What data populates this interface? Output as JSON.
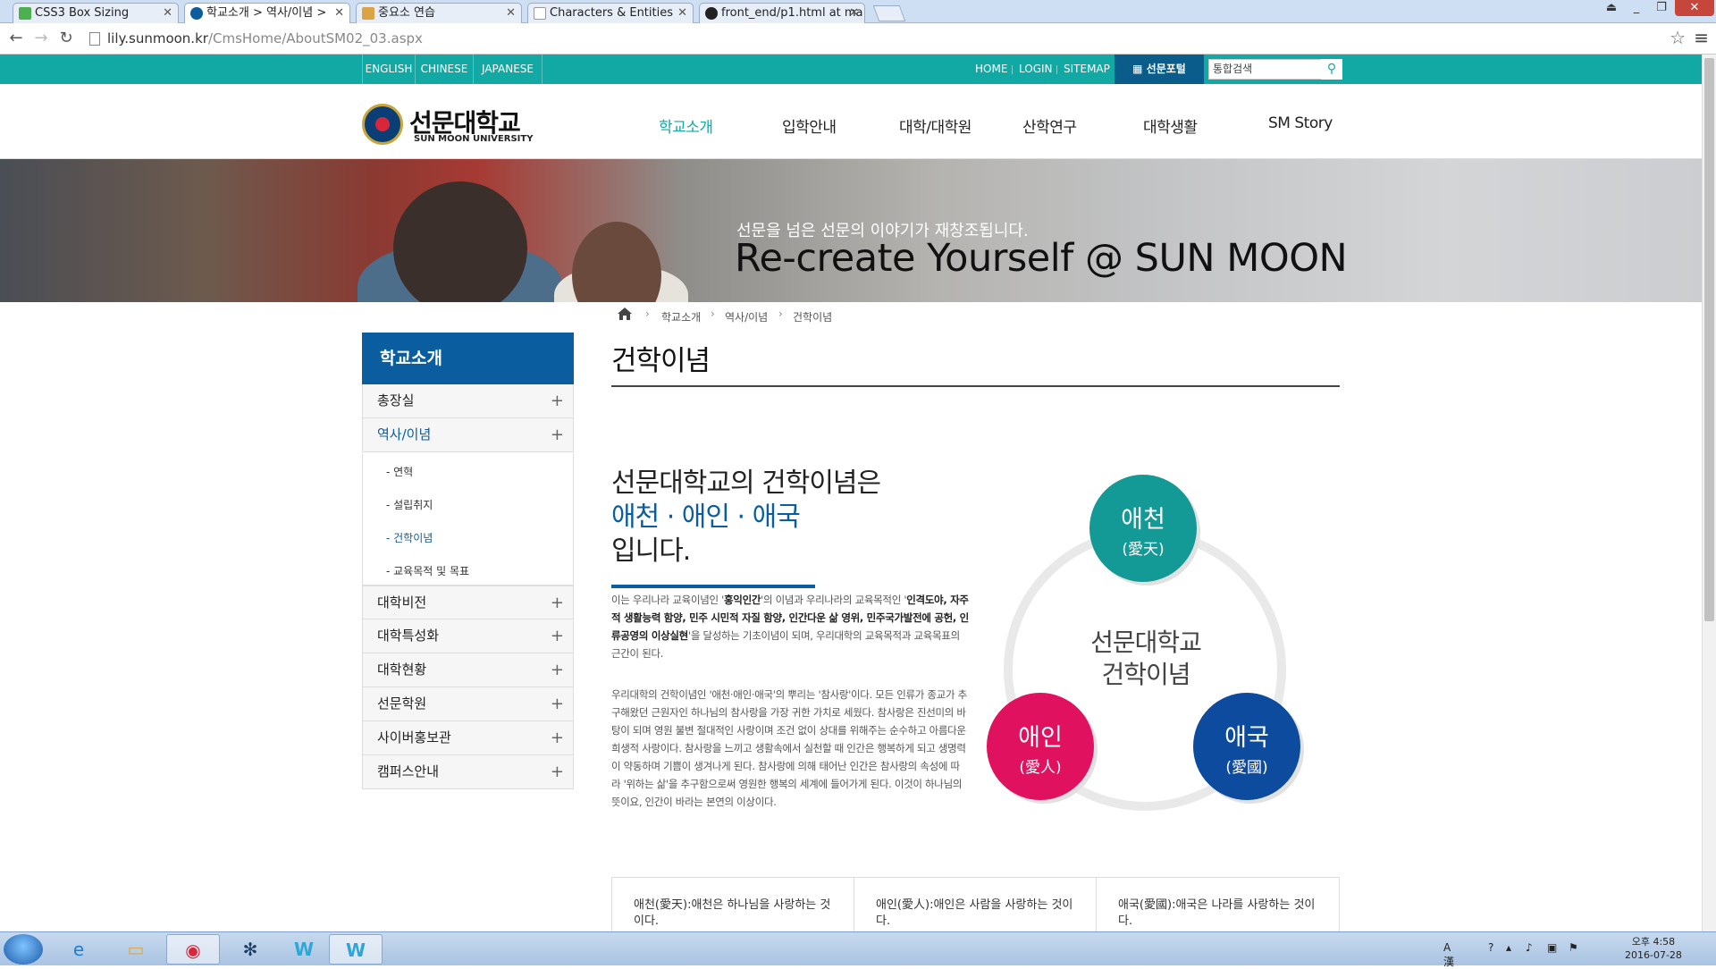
{
  "browser": {
    "tabs": [
      {
        "title": "CSS3 Box Sizing",
        "icon": "w3-icon",
        "color": "#4caf50"
      },
      {
        "title": "학교소개 > 역사/이념 >",
        "icon": "site-icon",
        "color": "#0a5d9e"
      },
      {
        "title": "중요소 연습",
        "icon": "page-icon",
        "color": "#d9a441"
      },
      {
        "title": "Characters & Entities",
        "icon": "doc-icon",
        "color": "#999999"
      },
      {
        "title": "front_end/p1.html at ma",
        "icon": "github-icon",
        "color": "#222222"
      }
    ],
    "url_host": "lily.sunmoon.kr",
    "url_path": "/CmsHome/AboutSM02_03.aspx"
  },
  "site": {
    "colors": {
      "teal": "#12a8a4",
      "navy": "#0a5d9e",
      "red": "#e0115f",
      "blue": "#0d4b9e",
      "teal_circle": "#149a96"
    },
    "languages": [
      "ENGLISH",
      "CHINESE",
      "JAPANESE"
    ],
    "utils": [
      "HOME",
      "LOGIN",
      "SITEMAP"
    ],
    "portal": "선문포털",
    "search_placeholder": "통합검색",
    "logo_kr": "선문대학교",
    "logo_en": "SUN MOON UNIVERSITY",
    "gnb": [
      "학교소개",
      "입학안내",
      "대학/대학원",
      "산학연구",
      "대학생활",
      "SM Story"
    ],
    "visual_sub": "선문을 넘은 선문의 이야기가 재창조됩니다.",
    "visual_main": "Re-create Yourself @ SUN MOON",
    "breadcrumb": [
      "학교소개",
      "역사/이념",
      "건학이념"
    ],
    "page_title": "건학이념",
    "lnb": {
      "title": "학교소개",
      "items": [
        "총장실",
        "역사/이념",
        "대학비전",
        "대학특성화",
        "대학현황",
        "선문학원",
        "사이버홍보관",
        "캠퍼스안내"
      ],
      "sub": [
        "- 연혁",
        "- 설립취지",
        "- 건학이념",
        "- 교육목적 및 목표"
      ]
    },
    "lead": [
      "선문대학교의 건학이념은",
      "애천 · 애인 · 애국",
      "입니다."
    ],
    "para1": {
      "a": "이는 우리나라 교육이념인 '",
      "b": "홍익인간",
      "c": "'의 이념과 우리나라의 교육목적인 '",
      "d": "인격도야, 자주적 생활능력 함양, 민주 시민적 자질 함양, 인간다운 삶 영위, 민주국가발전에 공헌, 인류공영의 이상실현",
      "e": "'을 달성하는 기초이념이 되며, 우리대학의 교육목적과 교육목표의 근간이 된다."
    },
    "para2": "우리대학의 건학이념인 '애천·애인·애국'의 뿌리는 '참사랑'이다. 모든 인류가 종교가 추구해왔던 근원자인 하나님의 참사랑을 가장 귀한 가치로 세웠다. 참사랑은 진선미의 바탕이 되며 영원 불변 절대적인 사랑이며 조건 없이 상대를 위해주는 순수하고 아름다운 희생적 사랑이다. 참사랑을 느끼고 생활속에서 실천할 때 인간은 행복하게 되고 생명력이 약동하며 기쁨이 생겨나게 된다. 참사랑에 의해 태어난 인간은 참사랑의 속성에 따라 '위하는 삶'을 추구함으로써 영원한 행복의 세계에 들어가게 된다. 이것이 하나님의 뜻이요, 인간이 바라는 본연의 이상이다.",
    "diagram": {
      "center": [
        "선문대학교",
        "건학이념"
      ],
      "circles": [
        {
          "kr": "애천",
          "hanja": "(愛天)"
        },
        {
          "kr": "애인",
          "hanja": "(愛人)"
        },
        {
          "kr": "애국",
          "hanja": "(愛國)"
        }
      ]
    },
    "table": [
      "애천(愛天):애천은 하나님을 사랑하는 것이다.",
      "애인(愛人):애인은 사람을 사랑하는 것이다.",
      "애국(愛國):애국은 나라를 사랑하는 것이다."
    ]
  },
  "taskbar": {
    "clock_time": "오후 4:58",
    "clock_date": "2016-07-28",
    "ime": "A 漢"
  }
}
